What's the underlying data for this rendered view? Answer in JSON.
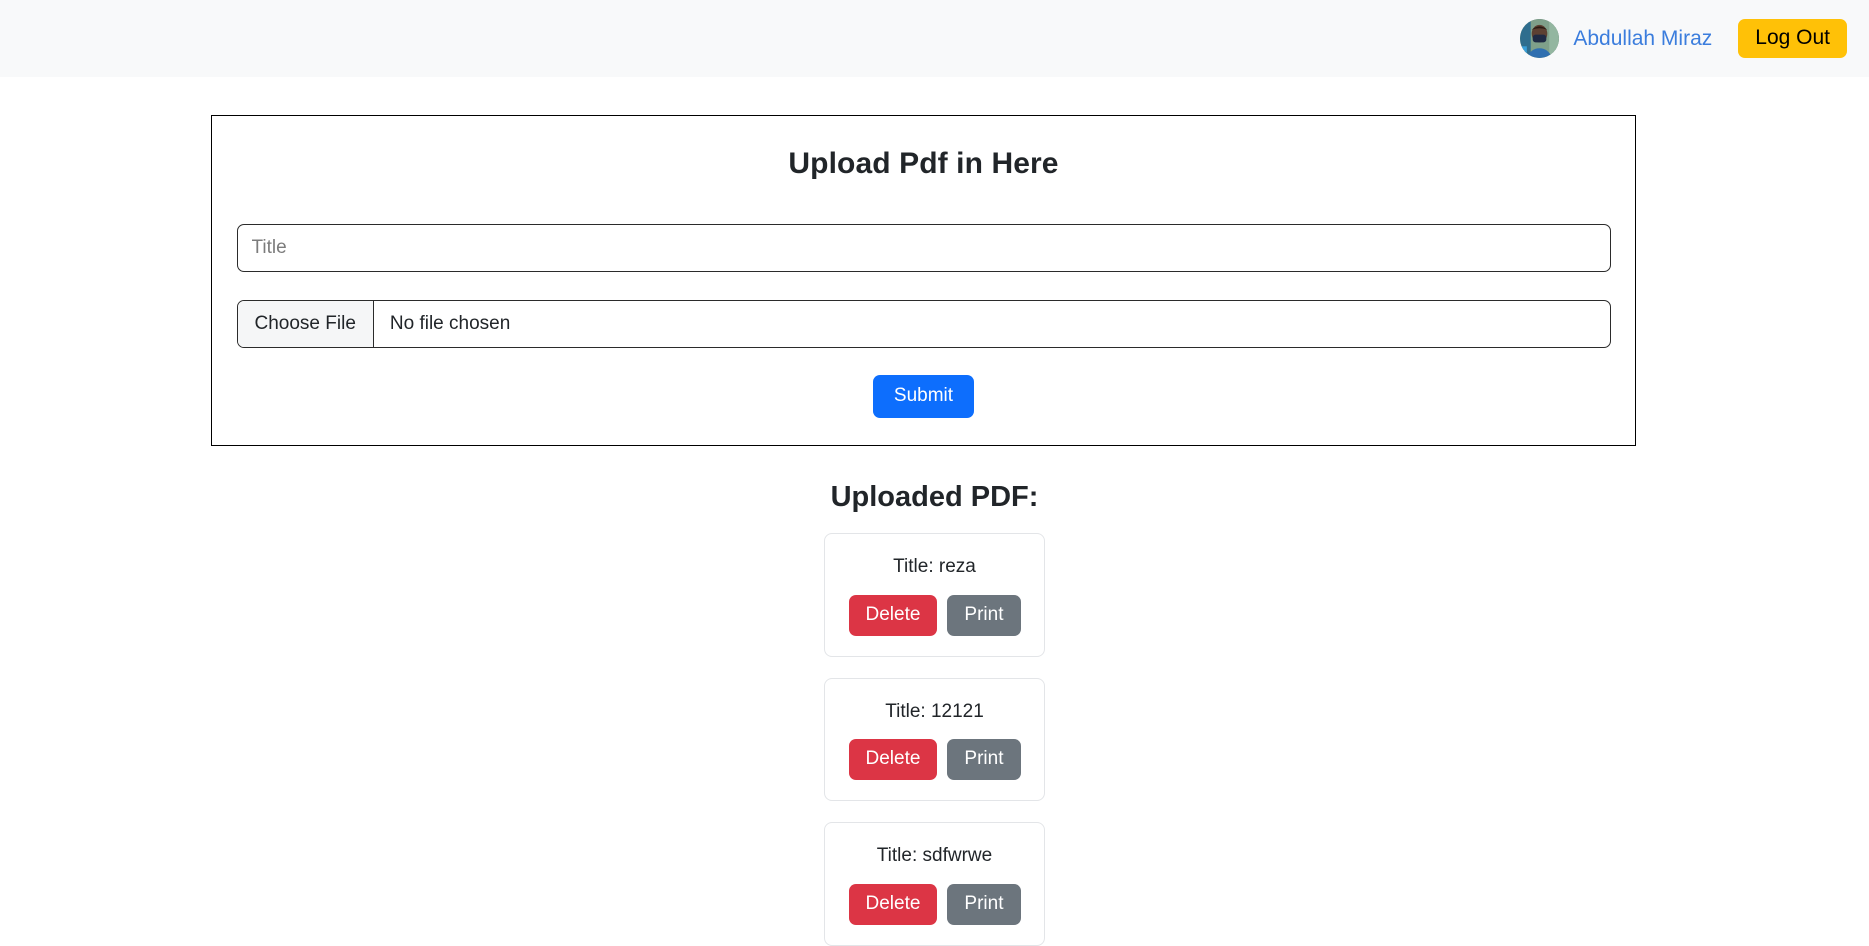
{
  "header": {
    "avatar_icon": "user-avatar-photo",
    "user_name": "Abdullah Miraz",
    "logout_label": "Log Out",
    "background_color": "#f8f9fa",
    "link_color": "#3b7ddd",
    "logout_color": "#ffc107"
  },
  "upload_form": {
    "heading": "Upload Pdf in Here",
    "title_input": {
      "value": "",
      "placeholder": "Title"
    },
    "file_input": {
      "button_label": "Choose File",
      "file_name": "No file chosen"
    },
    "submit_label": "Submit",
    "submit_color": "#0d6efd"
  },
  "uploaded": {
    "heading": "Uploaded PDF:",
    "delete_label": "Delete",
    "print_label": "Print",
    "delete_color": "#dc3545",
    "print_color": "#6c757d",
    "items": [
      {
        "title": "Title: reza"
      },
      {
        "title": "Title: 12121"
      },
      {
        "title": "Title: sdfwrwe"
      }
    ]
  }
}
